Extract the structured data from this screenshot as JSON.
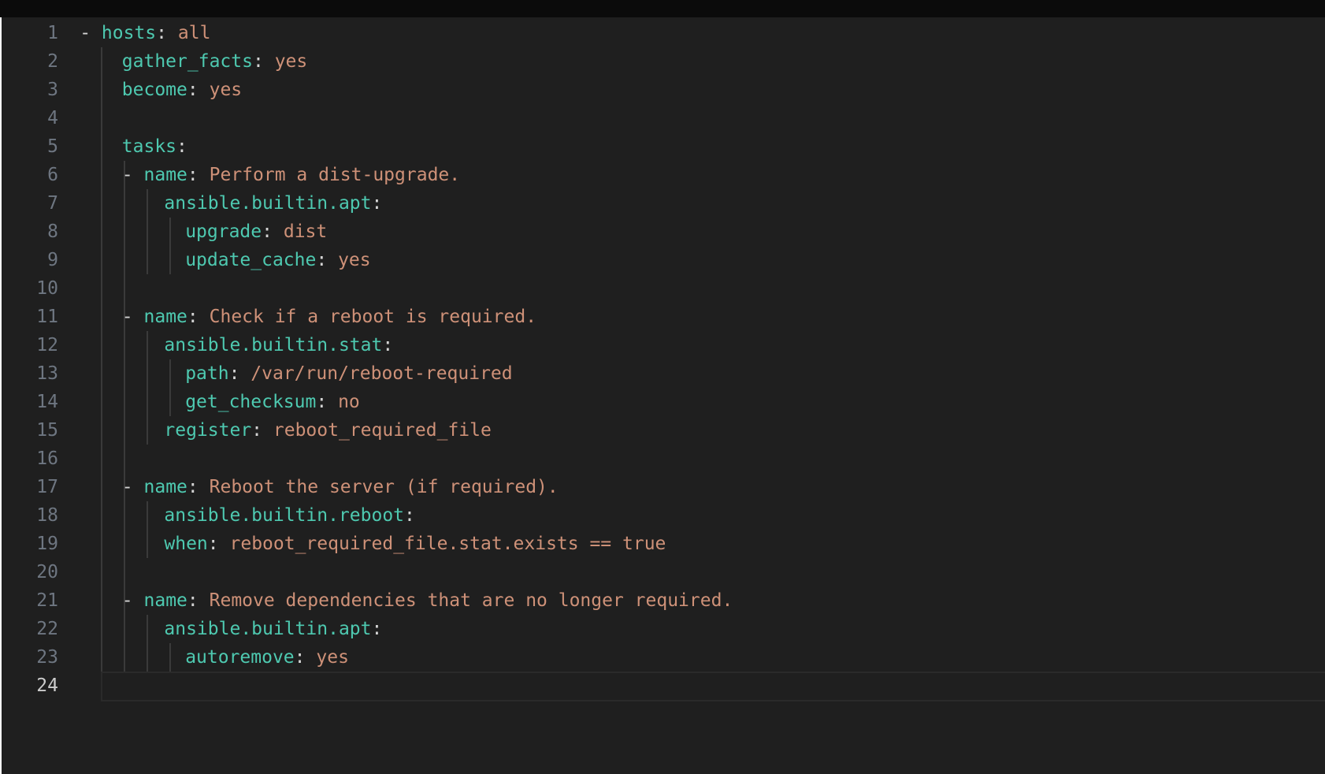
{
  "editor": {
    "current_line": "24",
    "lines": [
      {
        "num": "1",
        "dash": "-",
        "key": "hosts",
        "colon": ":",
        "value": "all"
      },
      {
        "num": "2",
        "dash": "",
        "key": "gather_facts",
        "colon": ":",
        "value": "yes"
      },
      {
        "num": "3",
        "dash": "",
        "key": "become",
        "colon": ":",
        "value": "yes"
      },
      {
        "num": "4",
        "dash": "",
        "key": "",
        "colon": "",
        "value": ""
      },
      {
        "num": "5",
        "dash": "",
        "key": "tasks",
        "colon": ":",
        "value": ""
      },
      {
        "num": "6",
        "dash": "-",
        "key": "name",
        "colon": ":",
        "value": "Perform a dist-upgrade."
      },
      {
        "num": "7",
        "dash": "",
        "key": "ansible.builtin.apt",
        "colon": ":",
        "value": ""
      },
      {
        "num": "8",
        "dash": "",
        "key": "upgrade",
        "colon": ":",
        "value": "dist"
      },
      {
        "num": "9",
        "dash": "",
        "key": "update_cache",
        "colon": ":",
        "value": "yes"
      },
      {
        "num": "10",
        "dash": "",
        "key": "",
        "colon": "",
        "value": ""
      },
      {
        "num": "11",
        "dash": "-",
        "key": "name",
        "colon": ":",
        "value": "Check if a reboot is required."
      },
      {
        "num": "12",
        "dash": "",
        "key": "ansible.builtin.stat",
        "colon": ":",
        "value": ""
      },
      {
        "num": "13",
        "dash": "",
        "key": "path",
        "colon": ":",
        "value": "/var/run/reboot-required"
      },
      {
        "num": "14",
        "dash": "",
        "key": "get_checksum",
        "colon": ":",
        "value": "no"
      },
      {
        "num": "15",
        "dash": "",
        "key": "register",
        "colon": ":",
        "value": "reboot_required_file"
      },
      {
        "num": "16",
        "dash": "",
        "key": "",
        "colon": "",
        "value": ""
      },
      {
        "num": "17",
        "dash": "-",
        "key": "name",
        "colon": ":",
        "value": "Reboot the server (if required)."
      },
      {
        "num": "18",
        "dash": "",
        "key": "ansible.builtin.reboot",
        "colon": ":",
        "value": ""
      },
      {
        "num": "19",
        "dash": "",
        "key": "when",
        "colon": ":",
        "value": "reboot_required_file.stat.exists == true"
      },
      {
        "num": "20",
        "dash": "",
        "key": "",
        "colon": "",
        "value": ""
      },
      {
        "num": "21",
        "dash": "-",
        "key": "name",
        "colon": ":",
        "value": "Remove dependencies that are no longer required."
      },
      {
        "num": "22",
        "dash": "",
        "key": "ansible.builtin.apt",
        "colon": ":",
        "value": ""
      },
      {
        "num": "23",
        "dash": "",
        "key": "autoremove",
        "colon": ":",
        "value": "yes"
      },
      {
        "num": "24",
        "dash": "",
        "key": "",
        "colon": "",
        "value": ""
      }
    ]
  }
}
